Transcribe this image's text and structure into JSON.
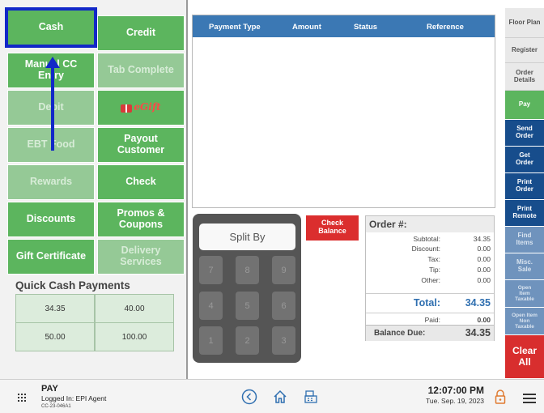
{
  "payment_buttons": [
    {
      "label": "Cash"
    },
    {
      "label": "Credit"
    },
    {
      "label": "Manual CC Entry"
    },
    {
      "label": "Tab Complete"
    },
    {
      "label": "Debit"
    },
    {
      "label": "eGift"
    },
    {
      "label": "EBT Food"
    },
    {
      "label": "Payout Customer"
    },
    {
      "label": "Rewards"
    },
    {
      "label": "Check"
    },
    {
      "label": "Discounts"
    },
    {
      "label": "Promos & Coupons"
    },
    {
      "label": "Gift Certificate"
    },
    {
      "label": "Delivery Services"
    }
  ],
  "quick_cash": {
    "title": "Quick Cash Payments",
    "amounts": [
      "34.35",
      "40.00",
      "50.00",
      "100.00"
    ]
  },
  "payments_table": {
    "columns": [
      "Payment Type",
      "Amount",
      "Status",
      "Reference"
    ],
    "rows": []
  },
  "keypad": {
    "split_by": "Split By",
    "keys": [
      "7",
      "8",
      "9",
      "4",
      "5",
      "6",
      "1",
      "2",
      "3"
    ]
  },
  "check_balance": "Check Balance",
  "order": {
    "header": "Order #:",
    "subtotal_label": "Subtotal:",
    "subtotal": "34.35",
    "discount_label": "Discount:",
    "discount": "0.00",
    "tax_label": "Tax:",
    "tax": "0.00",
    "tip_label": "Tip:",
    "tip": "0.00",
    "other_label": "Other:",
    "other": "0.00",
    "total_label": "Total:",
    "total": "34.35",
    "paid_label": "Paid:",
    "paid": "0.00",
    "balance_label": "Balance Due:",
    "balance": "34.35"
  },
  "sidebar": [
    {
      "label": "Floor Plan"
    },
    {
      "label": "Register"
    },
    {
      "label": "Order Details"
    },
    {
      "label": "Pay"
    },
    {
      "label": "Send Order"
    },
    {
      "label": "Get Order"
    },
    {
      "label": "Print Order"
    },
    {
      "label": "Print Remote"
    },
    {
      "label": "Find Items"
    },
    {
      "label": "Misc. Sale"
    },
    {
      "label": "Open Item Taxable"
    },
    {
      "label": "Open Item Non Taxable"
    },
    {
      "label": "Clear All"
    }
  ],
  "status_bar": {
    "title": "PAY",
    "logged_in": "Logged In: EPI Agent",
    "device_id": "CC-23-046A1",
    "time": "12:07:00 PM",
    "date": "Tue. Sep. 19, 2023"
  },
  "colors": {
    "accent_green": "#5cb55e",
    "header_blue": "#3b78b4",
    "nav_blue": "#174d8c",
    "alert_red": "#d82e2e",
    "highlight_blue": "#1228c8"
  }
}
